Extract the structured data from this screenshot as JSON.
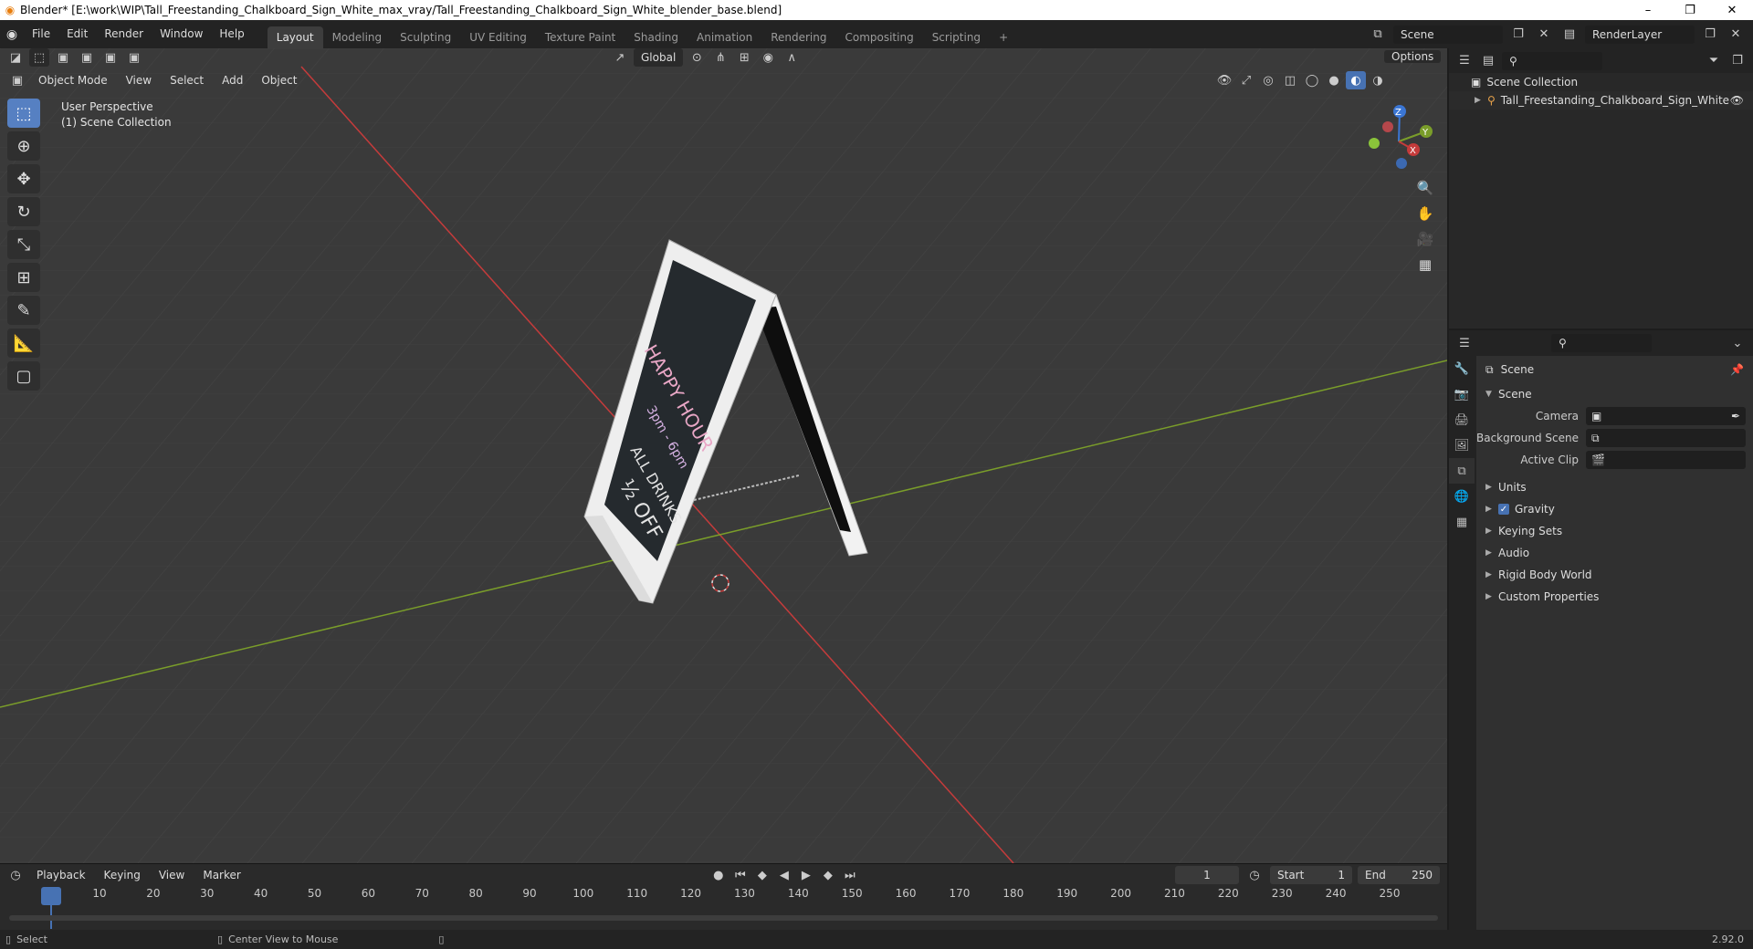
{
  "window": {
    "title": "Blender* [E:\\work\\WIP\\Tall_Freestanding_Chalkboard_Sign_White_max_vray/Tall_Freestanding_Chalkboard_Sign_White_blender_base.blend]",
    "controls": [
      "–",
      "❐",
      "✕"
    ]
  },
  "menu": [
    "File",
    "Edit",
    "Render",
    "Window",
    "Help"
  ],
  "workspaces": [
    "Layout",
    "Modeling",
    "Sculpting",
    "UV Editing",
    "Texture Paint",
    "Shading",
    "Animation",
    "Rendering",
    "Compositing",
    "Scripting"
  ],
  "active_workspace": "Layout",
  "scene_selector": {
    "value": "Scene"
  },
  "layer_selector": {
    "value": "RenderLayer"
  },
  "viewport": {
    "mode": "Object Mode",
    "menus": [
      "View",
      "Select",
      "Add",
      "Object"
    ],
    "transform_orientation": "Global",
    "options_label": "Options",
    "overlay_line1": "User Perspective",
    "overlay_line2": "(1) Scene Collection",
    "gizmo": {
      "z": "Z",
      "y": "Y",
      "x": "X"
    }
  },
  "sign": {
    "line1": "HAPPY HOUR",
    "line2": "3pm - 6pm",
    "line3": "ALL DRINKS",
    "line4": "½ OFF"
  },
  "timeline": {
    "menus": [
      "Playback",
      "Keying",
      "View",
      "Marker"
    ],
    "current_frame": "1",
    "start_label": "Start",
    "start_value": "1",
    "end_label": "End",
    "end_value": "250",
    "ticks": [
      "1",
      "10",
      "20",
      "30",
      "40",
      "50",
      "60",
      "70",
      "80",
      "90",
      "100",
      "110",
      "120",
      "130",
      "140",
      "150",
      "160",
      "170",
      "180",
      "190",
      "200",
      "210",
      "220",
      "230",
      "240",
      "250"
    ]
  },
  "status": {
    "select": "Select",
    "center_view": "Center View to Mouse",
    "version": "2.92.0"
  },
  "outliner": {
    "root": "Scene Collection",
    "items": [
      "Tall_Freestanding_Chalkboard_Sign_White"
    ]
  },
  "properties": {
    "context": "Scene",
    "panel_title": "Scene",
    "fields": [
      {
        "label": "Camera",
        "value": ""
      },
      {
        "label": "Background Scene",
        "value": ""
      },
      {
        "label": "Active Clip",
        "value": ""
      }
    ],
    "sections": [
      "Units",
      "Gravity",
      "Keying Sets",
      "Audio",
      "Rigid Body World",
      "Custom Properties"
    ],
    "gravity_checked": true
  },
  "colors": {
    "accent": "#4772b3",
    "x_axis": "#c53b3b",
    "y_axis": "#7a9d2a",
    "z_axis": "#3b76d4",
    "viewport_bg": "#3a3a3a"
  }
}
